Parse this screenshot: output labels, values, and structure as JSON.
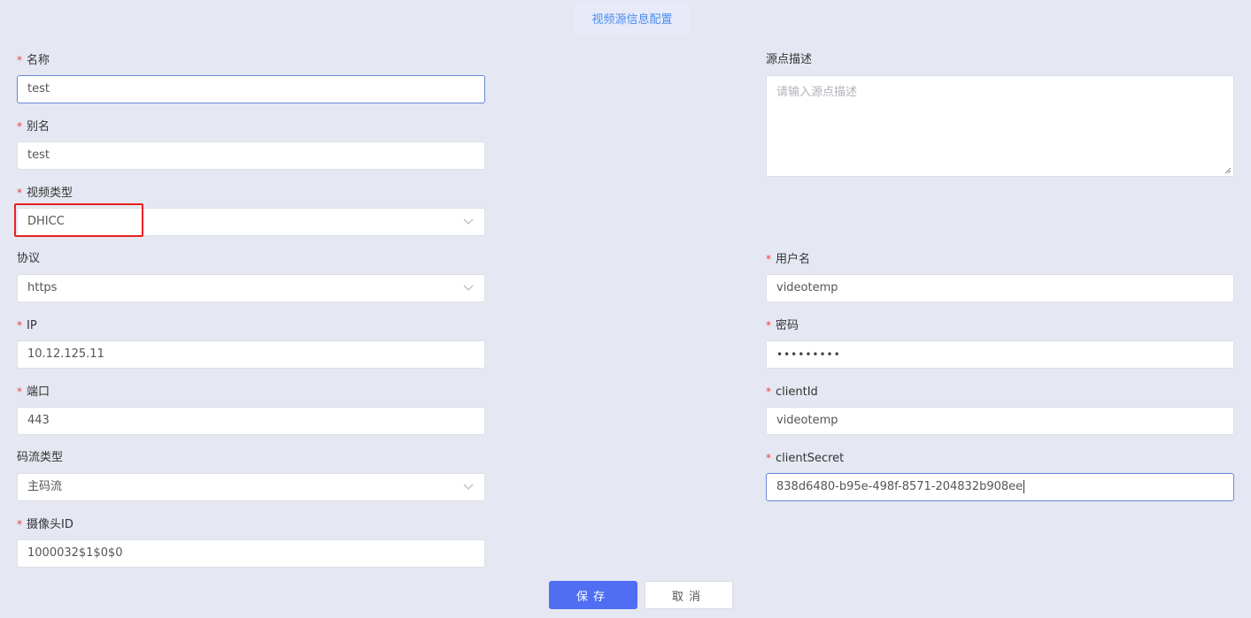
{
  "header": {
    "title": "视频源信息配置"
  },
  "form": {
    "name": {
      "label": "名称",
      "value": "test",
      "required": true
    },
    "alias": {
      "label": "别名",
      "value": "test",
      "required": true
    },
    "video_type": {
      "label": "视频类型",
      "value": "DHICC",
      "required": true
    },
    "protocol": {
      "label": "协议",
      "value": "https",
      "required": false
    },
    "ip": {
      "label": "IP",
      "value": "10.12.125.11",
      "required": true
    },
    "port": {
      "label": "端口",
      "value": "443",
      "required": true
    },
    "stream_type": {
      "label": "码流类型",
      "value": "主码流",
      "required": false
    },
    "camera_id": {
      "label": "摄像头ID",
      "value": "1000032$1$0$0",
      "required": true
    },
    "description": {
      "label": "源点描述",
      "placeholder": "请输入源点描述",
      "value": "",
      "required": false
    },
    "username": {
      "label": "用户名",
      "value": "videotemp",
      "required": true
    },
    "password": {
      "label": "密码",
      "masked_value": "•••••••••",
      "required": true
    },
    "client_id": {
      "label": "clientId",
      "value": "videotemp",
      "required": true
    },
    "client_secret": {
      "label": "clientSecret",
      "value": "838d6480-b95e-498f-8571-204832b908ee",
      "required": true
    }
  },
  "asterisk": "*",
  "actions": {
    "save_label": "保存",
    "cancel_label": "取消"
  },
  "icons": {
    "select_arrow": "chevron-down-icon"
  },
  "colors": {
    "primary": "#4f6ef2",
    "required": "#f04040",
    "highlight": "#e82020",
    "title": "#4a8ef0"
  }
}
